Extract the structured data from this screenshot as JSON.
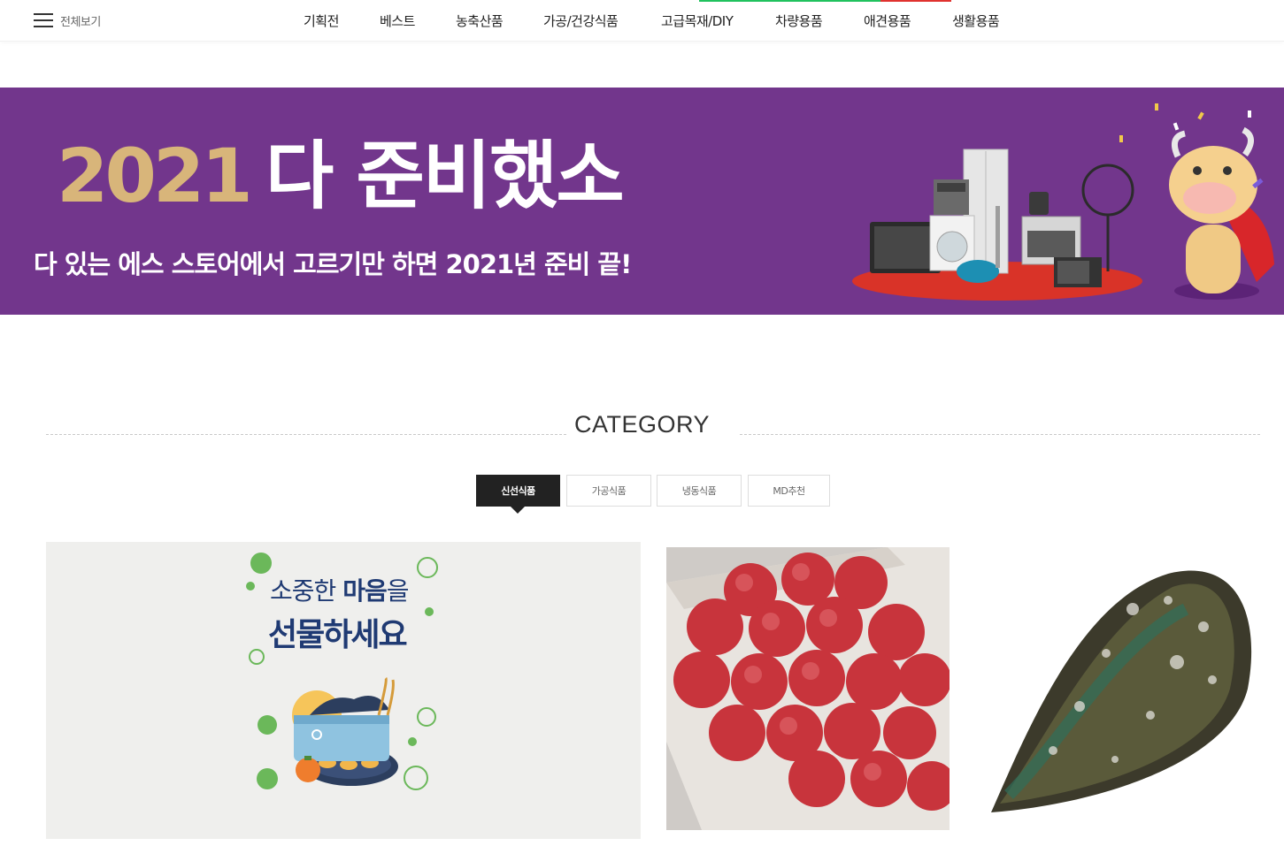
{
  "header": {
    "all_view_label": "전체보기",
    "menu": [
      "기획전",
      "베스트",
      "농축산품",
      "가공/건강식품",
      "고급목재/DIY",
      "차량용품",
      "애견용품",
      "생활용품"
    ]
  },
  "banner": {
    "year": "2021",
    "headline": "다 준비했소",
    "subtitle": "다 있는 에스 스토어에서 고르기만 하면 2021년 준비 끝!"
  },
  "category": {
    "title": "CATEGORY",
    "tabs": [
      "신선식품",
      "가공식품",
      "냉동식품",
      "MD추천"
    ],
    "active_tab": "신선식품"
  },
  "promo": {
    "line1_prefix": "소중한 ",
    "line1_bold": "마음",
    "line1_suffix": "을",
    "line2": "선물하세요"
  },
  "colors": {
    "banner_bg": "#72368c",
    "year_gold": "#d8b57a",
    "nav_green": "#21c25e",
    "nav_red": "#e0322f",
    "promo_navy": "#1f3a73",
    "accent_green": "#6bb85a"
  },
  "icons": {
    "menu": "hamburger-menu-icon"
  }
}
